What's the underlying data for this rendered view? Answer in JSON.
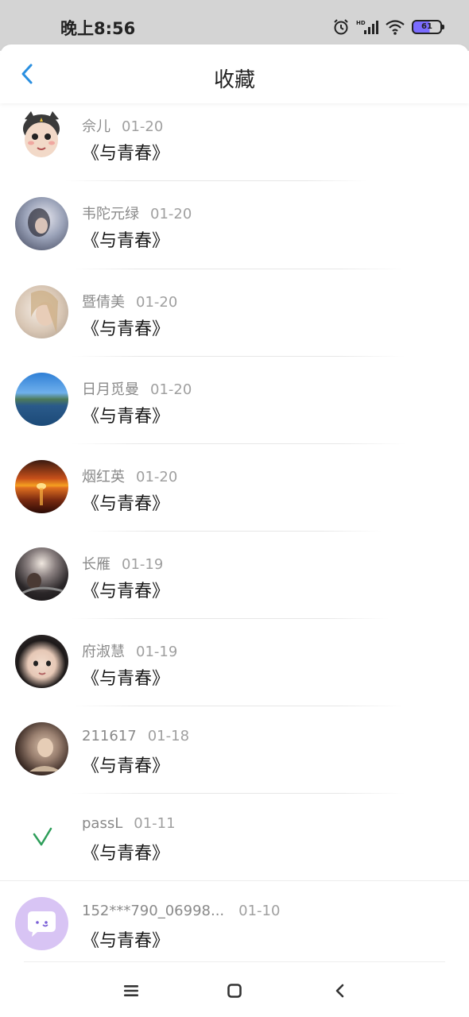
{
  "status_bar": {
    "time": "晚上8:56",
    "battery": "61",
    "icons": [
      "alarm-icon",
      "hd-signal-icon",
      "wifi-icon",
      "battery-icon"
    ]
  },
  "nav": {
    "title": "收藏",
    "back_icon": "chevron-left-icon"
  },
  "colors": {
    "accent": "#2a8fe0",
    "text_primary": "#1a1a1a",
    "text_secondary": "#8a8a8a",
    "status_bar_bg": "#d4d4d4"
  },
  "items": [
    {
      "name": "佘儿",
      "date": "01-20",
      "title": "《与青春》"
    },
    {
      "name": "韦陀元绿",
      "date": "01-20",
      "title": "《与青春》"
    },
    {
      "name": "暨倩美",
      "date": "01-20",
      "title": "《与青春》"
    },
    {
      "name": "日月觅曼",
      "date": "01-20",
      "title": "《与青春》"
    },
    {
      "name": "烟红英",
      "date": "01-20",
      "title": "《与青春》"
    },
    {
      "name": "长雁",
      "date": "01-19",
      "title": "《与青春》"
    },
    {
      "name": "府淑慧",
      "date": "01-19",
      "title": "《与青春》"
    },
    {
      "name": "211617",
      "date": "01-18",
      "title": "《与青春》"
    },
    {
      "name": "passL",
      "date": "01-11",
      "title": "《与青春》"
    },
    {
      "name": "152***790_06998...",
      "date": "01-10",
      "title": "《与青春》"
    }
  ],
  "bottom_nav": [
    "menu-icon",
    "home-square-icon",
    "back-chevron-icon"
  ]
}
